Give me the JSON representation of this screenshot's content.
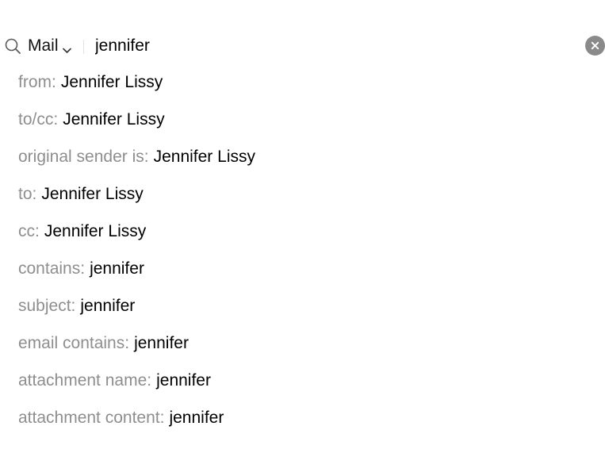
{
  "search": {
    "scope": "Mail",
    "query": "jennifer",
    "icons": {
      "search": "magnifier-icon",
      "scope_dropdown": "chevron-down-icon",
      "clear": "clear-x-circle-icon"
    }
  },
  "suggestions": [
    {
      "prefix": "from:",
      "value": "Jennifer Lissy"
    },
    {
      "prefix": "to/cc:",
      "value": "Jennifer Lissy"
    },
    {
      "prefix": "original sender is:",
      "value": "Jennifer Lissy"
    },
    {
      "prefix": "to:",
      "value": "Jennifer Lissy"
    },
    {
      "prefix": "cc:",
      "value": "Jennifer Lissy"
    },
    {
      "prefix": "contains:",
      "value": "jennifer"
    },
    {
      "prefix": "subject:",
      "value": "jennifer"
    },
    {
      "prefix": "email contains:",
      "value": "jennifer"
    },
    {
      "prefix": "attachment name:",
      "value": "jennifer"
    },
    {
      "prefix": "attachment content:",
      "value": "jennifer"
    }
  ],
  "colors": {
    "prefix_text": "#8e8e8e",
    "value_text": "#000000",
    "clear_button": "#8a8a8a",
    "background": "#ffffff"
  }
}
